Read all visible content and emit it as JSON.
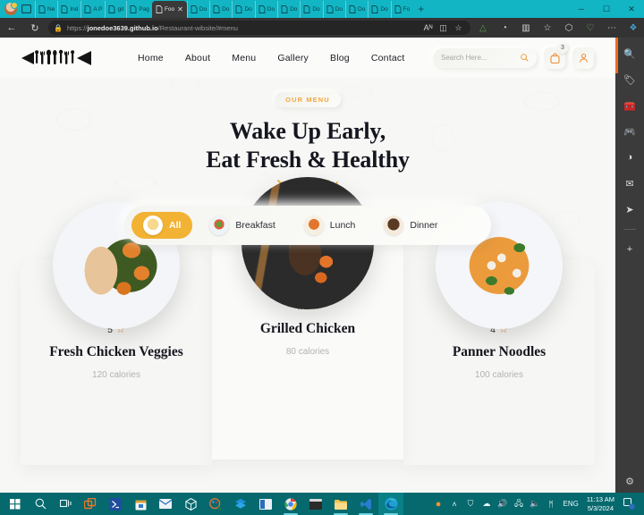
{
  "browser": {
    "tabs": [
      {
        "label": "Ne",
        "active": false
      },
      {
        "label": "Ind",
        "active": false
      },
      {
        "label": "A P",
        "active": false
      },
      {
        "label": "git",
        "active": false
      },
      {
        "label": "Pag",
        "active": false
      },
      {
        "label": "Foo",
        "active": true
      },
      {
        "label": "Do",
        "active": false
      },
      {
        "label": "Do",
        "active": false
      },
      {
        "label": "Do",
        "active": false
      },
      {
        "label": "Do",
        "active": false
      },
      {
        "label": "Do",
        "active": false
      },
      {
        "label": "Do",
        "active": false
      },
      {
        "label": "Do",
        "active": false
      },
      {
        "label": "Do",
        "active": false
      },
      {
        "label": "Do",
        "active": false
      },
      {
        "label": "Fo",
        "active": false
      }
    ],
    "new_tab_label": "+",
    "window_controls": {
      "minimize": "─",
      "maximize": "☐",
      "close": "✕"
    },
    "nav": {
      "back": "←",
      "refresh": "↻",
      "lock": "🔒"
    },
    "url": {
      "scheme": "https://",
      "domain": "jonedoe3639.github.io",
      "path": "/Restaurant-wibsite/#menu",
      "full": "https://jonedoe3639.github.io/Restaurant-wibsite/#menu"
    },
    "omnibox_actions": [
      {
        "icon": "read-aloud-icon",
        "glyph": "Aᴺ"
      },
      {
        "icon": "immersive-reader-icon",
        "glyph": "◫"
      },
      {
        "icon": "favorite-star-icon",
        "glyph": "☆"
      }
    ],
    "toolbar_extensions": [
      {
        "icon": "google-drive-icon",
        "glyph": "△"
      },
      {
        "icon": "extension-clock-icon",
        "glyph": "◔"
      },
      {
        "icon": "split-screen-icon",
        "glyph": "▥"
      },
      {
        "icon": "collections-icon",
        "glyph": "☆"
      },
      {
        "icon": "browser-essentials-icon",
        "glyph": "⬡"
      },
      {
        "icon": "heart-shield-icon",
        "glyph": "♡"
      },
      {
        "icon": "settings-more-icon",
        "glyph": "⋯"
      },
      {
        "icon": "copilot-icon",
        "glyph": "❖"
      }
    ]
  },
  "site": {
    "logo_name": "cutlery-fish-logo",
    "nav_links": [
      {
        "label": "Home"
      },
      {
        "label": "About"
      },
      {
        "label": "Menu"
      },
      {
        "label": "Gallery"
      },
      {
        "label": "Blog"
      },
      {
        "label": "Contact"
      }
    ],
    "search": {
      "placeholder": "Search Here...",
      "value": ""
    },
    "cart": {
      "badge": "3"
    },
    "hero": {
      "eyebrow": "OUR MENU",
      "title_line1": "Wake Up Early,",
      "title_line2": "Eat Fresh & Healthy"
    },
    "filters": [
      {
        "label": "All",
        "active": true,
        "thumb": "all"
      },
      {
        "label": "Breakfast",
        "active": false,
        "thumb": "bfast"
      },
      {
        "label": "Lunch",
        "active": false,
        "thumb": "lunch"
      },
      {
        "label": "Dinner",
        "active": false,
        "thumb": "dinner"
      }
    ],
    "cards": [
      {
        "name": "Fresh Chicken Veggies",
        "rating": "5",
        "calories": "120 calories",
        "dish": "d1",
        "raised": false
      },
      {
        "name": "Grilled Chicken",
        "rating": "4.3",
        "calories": "80 calories",
        "dish": "d2",
        "raised": true
      },
      {
        "name": "Panner Noodles",
        "rating": "4",
        "calories": "100 calories",
        "dish": "d3",
        "raised": false
      }
    ],
    "colors": {
      "accent_yellow": "#f2b233",
      "accent_orange": "#e8762a",
      "text_dark": "#15161f",
      "page_bg": "#f7f7f5"
    }
  },
  "sidebar": {
    "items": [
      {
        "name": "search-icon",
        "glyph": "🔍"
      },
      {
        "name": "shopping-tag-icon",
        "glyph": "🏷"
      },
      {
        "name": "tools-briefcase-icon",
        "glyph": "🧰"
      },
      {
        "name": "games-icon",
        "glyph": "🎮"
      },
      {
        "name": "office-icon",
        "glyph": "◑"
      },
      {
        "name": "outlook-icon",
        "glyph": "✉"
      },
      {
        "name": "telegram-icon",
        "glyph": "➤"
      },
      {
        "name": "add-sidebar-app-icon",
        "glyph": "+"
      }
    ],
    "settings_glyph": "⚙"
  },
  "taskbar": {
    "apps": [
      {
        "name": "start-button"
      },
      {
        "name": "search-taskbar-icon"
      },
      {
        "name": "task-view-icon"
      },
      {
        "name": "app-orange-squares-icon"
      },
      {
        "name": "app-powershell-icon"
      },
      {
        "name": "app-store-icon"
      },
      {
        "name": "app-mail-icon"
      },
      {
        "name": "app-cube-icon"
      },
      {
        "name": "app-paint-icon"
      },
      {
        "name": "app-dropbox-icon"
      },
      {
        "name": "app-window-icon"
      },
      {
        "name": "app-chrome-icon"
      },
      {
        "name": "app-terminal-icon"
      },
      {
        "name": "app-file-explorer-icon"
      },
      {
        "name": "app-vscode-icon"
      },
      {
        "name": "app-edge-icon"
      }
    ],
    "tray": [
      {
        "name": "firefox-tray-icon",
        "glyph": "●"
      },
      {
        "name": "show-hidden-icons-chevron",
        "glyph": "˄"
      },
      {
        "name": "antivirus-tray-icon",
        "glyph": "⛉"
      },
      {
        "name": "onedrive-tray-icon",
        "glyph": "☁"
      },
      {
        "name": "speaker-mute-icon",
        "glyph": "🔊"
      },
      {
        "name": "network-icon",
        "glyph": "🖧"
      },
      {
        "name": "volume-icon",
        "glyph": "🔈"
      },
      {
        "name": "bluetooth-icon",
        "glyph": "ᛗ"
      }
    ],
    "language": "ENG",
    "time": "11:13 AM",
    "date": "5/3/2024",
    "notification_badge": "1"
  }
}
